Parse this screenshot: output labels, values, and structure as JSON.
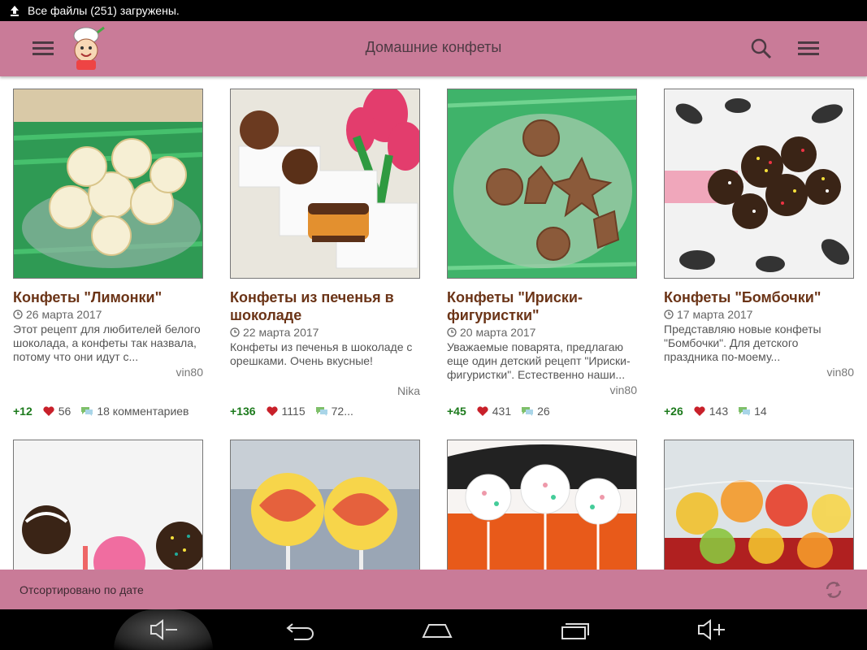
{
  "status": {
    "text": "Все файлы (251) загружены."
  },
  "header": {
    "title": "Домашние конфеты"
  },
  "cards": [
    {
      "title": "Конфеты \"Лимонки\"",
      "date": "26 марта 2017",
      "desc": "Этот рецепт для любителей белого шоколада, а конфеты так назвала, потому что они идут с...",
      "author": "vin80",
      "score": "+12",
      "likes": "56",
      "comments": "18 комментариев"
    },
    {
      "title": "Конфеты из печенья в шоколаде",
      "date": "22 марта 2017",
      "desc": "Конфеты из печенья в шоколаде с орешками. Очень вкусные!",
      "author": "Nika",
      "score": "+136",
      "likes": "1115",
      "comments": "72..."
    },
    {
      "title": "Конфеты \"Ириски-фигуристки\"",
      "date": "20 марта 2017",
      "desc": "Уважаемые поварята, предлагаю еще один детский рецепт \"Ириски-фигуристки\". Естественно наши...",
      "author": "vin80",
      "score": "+45",
      "likes": "431",
      "comments": "26"
    },
    {
      "title": "Конфеты \"Бомбочки\"",
      "date": "17 марта 2017",
      "desc": "Представляю новые конфеты \"Бомбочки\". Для детского праздника по-моему...",
      "author": "vin80",
      "score": "+26",
      "likes": "143",
      "comments": "14"
    }
  ],
  "sort": {
    "label": "Отсортировано по дате"
  },
  "colors": {
    "appbar": "#c97b98",
    "title": "#6b3417",
    "score": "#1c7a1c"
  }
}
